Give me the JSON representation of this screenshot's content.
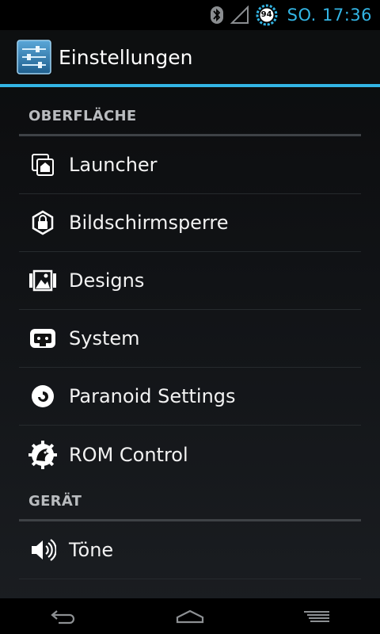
{
  "status_bar": {
    "battery_level": "94",
    "clock": "SO. 17:36",
    "accent_color": "#33b5e5"
  },
  "action_bar": {
    "title": "Einstellungen",
    "icon": "settings-sliders-icon"
  },
  "sections": [
    {
      "header": "OBERFLÄCHE",
      "items": [
        {
          "label": "Launcher",
          "icon": "launcher-icon"
        },
        {
          "label": "Bildschirmsperre",
          "icon": "lockscreen-icon"
        },
        {
          "label": "Designs",
          "icon": "themes-icon"
        },
        {
          "label": "System",
          "icon": "system-icon"
        },
        {
          "label": "Paranoid Settings",
          "icon": "paranoid-icon"
        },
        {
          "label": "ROM Control",
          "icon": "rom-control-icon"
        }
      ]
    },
    {
      "header": "GERÄT",
      "items": [
        {
          "label": "Töne",
          "icon": "sound-icon"
        }
      ]
    }
  ],
  "nav_bar": {
    "buttons": [
      "back-icon",
      "home-icon",
      "menu-icon"
    ]
  }
}
